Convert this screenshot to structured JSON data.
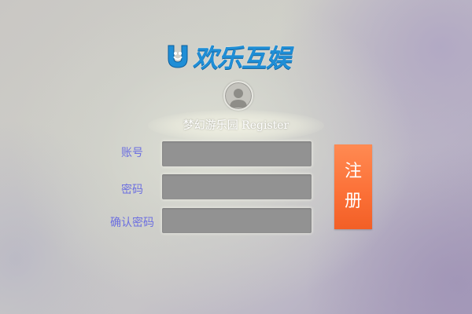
{
  "brand": {
    "name": "欢乐互娱",
    "icon": "smile-u-logo-icon",
    "color": "#1f8ed6"
  },
  "avatar": {
    "icon": "user-avatar-icon"
  },
  "title": "梦幻游乐园 Register",
  "form": {
    "account_label": "账号",
    "account_value": "",
    "password_label": "密码",
    "password_value": "",
    "confirm_label": "确认密码",
    "confirm_value": "",
    "label_color": "#6c6fe0",
    "field_color": "#929292"
  },
  "register_button": {
    "char_1": "注",
    "char_2": "册",
    "color": "#fb6f36"
  }
}
